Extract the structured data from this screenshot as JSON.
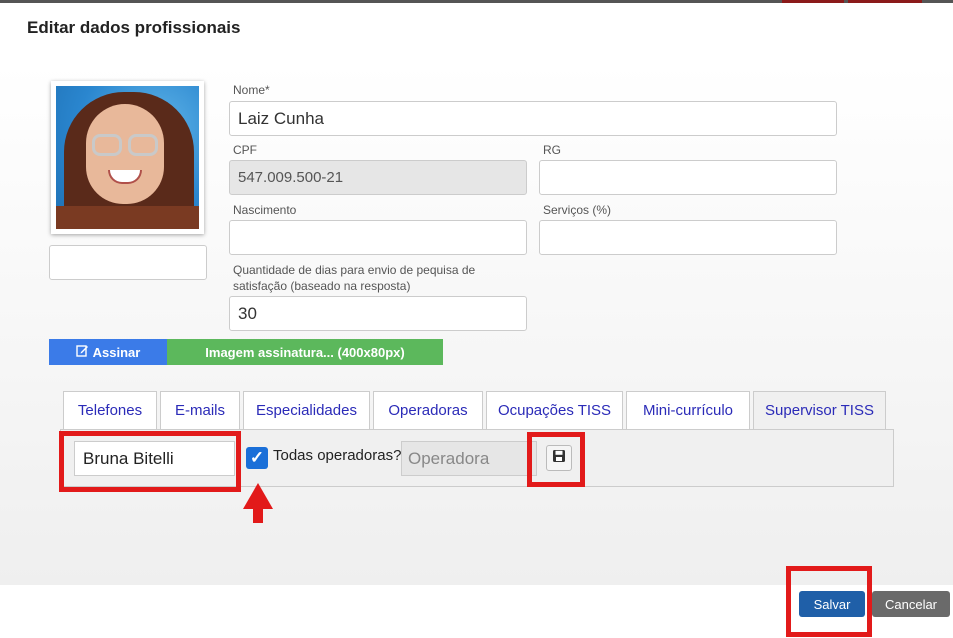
{
  "modal": {
    "title": "Editar dados profissionais"
  },
  "form": {
    "nome_label": "Nome*",
    "nome_value": "Laiz Cunha",
    "cpf_label": "CPF",
    "cpf_value": "547.009.500-21",
    "rg_label": "RG",
    "rg_value": "",
    "nascimento_label": "Nascimento",
    "nascimento_value": "",
    "servicos_label": "Serviços (%)",
    "servicos_value": "",
    "pesquisa_label_line1": "Quantidade de dias para envio de pequisa de",
    "pesquisa_label_line2": "satisfação (baseado na resposta)",
    "pesquisa_value": "30",
    "photo_caption_value": ""
  },
  "buttons": {
    "assinar": "Assinar",
    "imagem_assinatura": "Imagem assinatura... (400x80px)",
    "salvar": "Salvar",
    "cancelar": "Cancelar"
  },
  "tabs": [
    {
      "label": "Telefones"
    },
    {
      "label": "E-mails"
    },
    {
      "label": "Especialidades"
    },
    {
      "label": "Operadoras"
    },
    {
      "label": "Ocupações TISS"
    },
    {
      "label": "Mini-currículo"
    },
    {
      "label": "Supervisor TISS",
      "active": true
    }
  ],
  "supervisor_panel": {
    "supervisor_value": "Bruna Bitelli",
    "todas_operadoras_label": "Todas operadoras?",
    "todas_operadoras_checked": true,
    "operadora_placeholder": "Operadora"
  },
  "icons": {
    "assinar": "edit-icon",
    "save": "floppy-disk-icon",
    "checkbox": "checkmark-icon"
  },
  "colors": {
    "primary_blue": "#3b7be8",
    "success_green": "#5cb85c",
    "annotation_red": "#e21a1a",
    "salvar_blue": "#1f5fa8",
    "cancelar_gray": "#6a6a6a",
    "tab_text": "#2b2bb8"
  }
}
